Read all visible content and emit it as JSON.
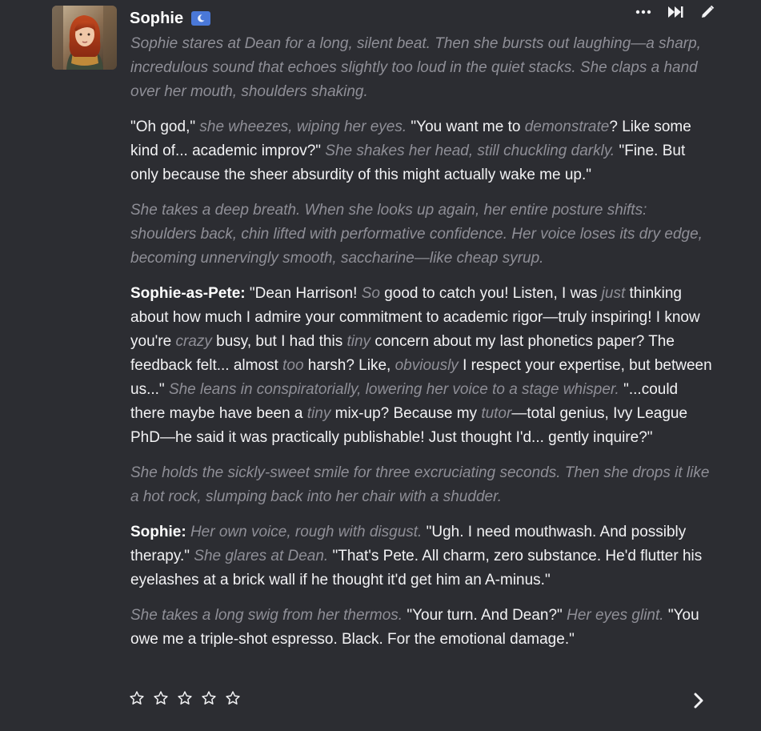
{
  "message": {
    "author_name": "Sophie",
    "avatar_description_icon": "avatar-image",
    "badge_icon": "moon-icon",
    "colors": {
      "background": "#2c2d32",
      "text": "#f2f2f4",
      "narration": "#8f8f97",
      "badge": "#4a78d8"
    },
    "actions": [
      {
        "name": "more-icon"
      },
      {
        "name": "fast-forward-icon"
      },
      {
        "name": "edit-icon"
      }
    ],
    "paragraphs": [
      {
        "segments": [
          {
            "style": "em",
            "text": "Sophie stares at Dean for a long, silent beat. Then she bursts out laughing—a sharp, incredulous sound that echoes slightly too loud in the quiet stacks. She claps a hand over her mouth, shoulders shaking."
          }
        ]
      },
      {
        "segments": [
          {
            "style": "plain",
            "text": "\"Oh god,\" "
          },
          {
            "style": "em",
            "text": "she wheezes, wiping her eyes."
          },
          {
            "style": "plain",
            "text": " \"You want me to "
          },
          {
            "style": "em",
            "text": "demonstrate"
          },
          {
            "style": "plain",
            "text": "? Like some kind of... academic improv?\" "
          },
          {
            "style": "em",
            "text": "She shakes her head, still chuckling darkly."
          },
          {
            "style": "plain",
            "text": " \"Fine. But only because the sheer absurdity of this might actually wake me up.\""
          }
        ]
      },
      {
        "segments": [
          {
            "style": "em",
            "text": "She takes a deep breath. When she looks up again, her entire posture shifts: shoulders back, chin lifted with performative confidence. Her voice loses its dry edge, becoming unnervingly smooth, saccharine—like cheap syrup."
          }
        ]
      },
      {
        "segments": [
          {
            "style": "strong",
            "text": "Sophie-as-Pete:"
          },
          {
            "style": "plain",
            "text": " \"Dean Harrison! "
          },
          {
            "style": "em",
            "text": "So"
          },
          {
            "style": "plain",
            "text": " good to catch you! Listen, I was "
          },
          {
            "style": "em",
            "text": "just"
          },
          {
            "style": "plain",
            "text": " thinking about how much I admire your commitment to academic rigor—truly inspiring! I know you're "
          },
          {
            "style": "em",
            "text": "crazy"
          },
          {
            "style": "plain",
            "text": " busy, but I had this "
          },
          {
            "style": "em",
            "text": "tiny"
          },
          {
            "style": "plain",
            "text": " concern about my last phonetics paper? The feedback felt... almost "
          },
          {
            "style": "em",
            "text": "too"
          },
          {
            "style": "plain",
            "text": " harsh? Like, "
          },
          {
            "style": "em",
            "text": "obviously"
          },
          {
            "style": "plain",
            "text": " I respect your expertise, but between us...\" "
          },
          {
            "style": "em",
            "text": "She leans in conspiratorially, lowering her voice to a stage whisper."
          },
          {
            "style": "plain",
            "text": " \"...could there maybe have been a "
          },
          {
            "style": "em",
            "text": "tiny"
          },
          {
            "style": "plain",
            "text": " mix-up? Because my "
          },
          {
            "style": "em",
            "text": "tutor"
          },
          {
            "style": "plain",
            "text": "—total genius, Ivy League PhD—he said it was practically publishable! Just thought I'd... gently inquire?\""
          }
        ]
      },
      {
        "segments": [
          {
            "style": "em",
            "text": "She holds the sickly-sweet smile for three excruciating seconds. Then she drops it like a hot rock, slumping back into her chair with a shudder."
          }
        ]
      },
      {
        "segments": [
          {
            "style": "strong",
            "text": "Sophie:"
          },
          {
            "style": "plain",
            "text": " "
          },
          {
            "style": "em",
            "text": "Her own voice, rough with disgust."
          },
          {
            "style": "plain",
            "text": " \"Ugh. I need mouthwash. And possibly therapy.\" "
          },
          {
            "style": "em",
            "text": "She glares at Dean."
          },
          {
            "style": "plain",
            "text": " \"That's Pete. All charm, zero substance. He'd flutter his eyelashes at a brick wall if he thought it'd get him an A-minus.\""
          }
        ]
      },
      {
        "segments": [
          {
            "style": "em",
            "text": "She takes a long swig from her thermos."
          },
          {
            "style": "plain",
            "text": " \"Your turn. And Dean?\" "
          },
          {
            "style": "em",
            "text": "Her eyes glint."
          },
          {
            "style": "plain",
            "text": " \"You owe me a triple-shot espresso. Black. For the emotional damage.\""
          }
        ]
      }
    ],
    "rating": {
      "max_stars": 5,
      "value": 0,
      "star_icon": "star-outline-icon"
    },
    "next_icon": "chevron-right-icon"
  }
}
